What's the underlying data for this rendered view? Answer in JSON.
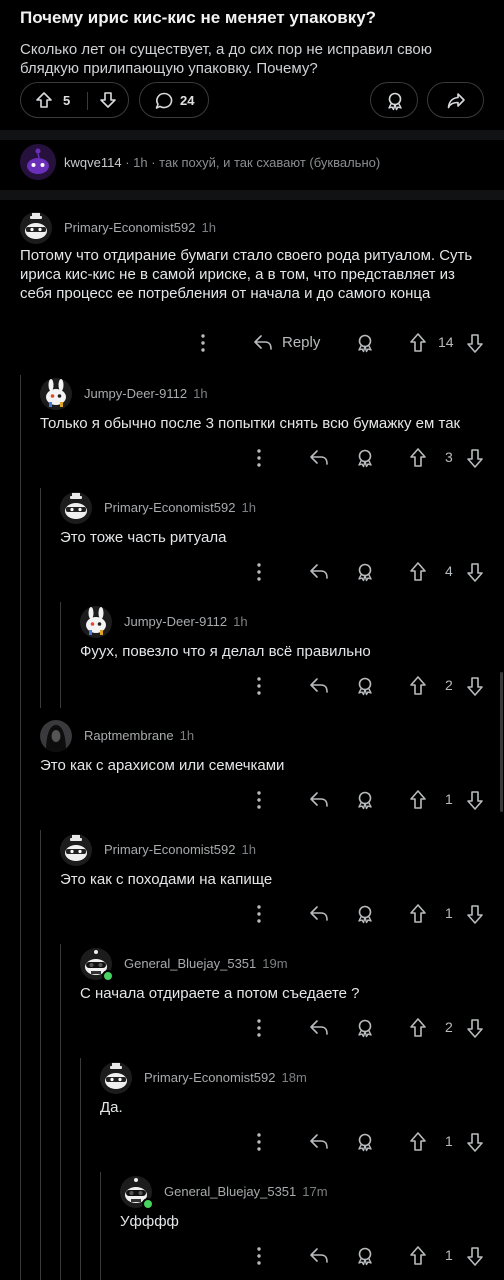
{
  "post": {
    "title": "Почему ирис кис-кис не меняет упаковку?",
    "body": "Сколько лет он существует, а до сих пор не исправил свою блядкую прилипающую упаковку. Почему?",
    "upvotes": "5",
    "comments": "24"
  },
  "top_comment": {
    "user": "kwqve114",
    "time": "1h",
    "text": "так похуй, и так схавают (буквально)"
  },
  "comments": [
    {
      "user": "Primary-Economist592",
      "time": "1h",
      "text": "Потому что отдирание бумаги стало своего рода ритуалом. Суть ириса кис-кис не в самой ириске, а в том, что представляет из себя процесс ее потребления от начала и до самого конца",
      "votes": "14",
      "reply_label": "Reply"
    },
    {
      "user": "Jumpy-Deer-9112",
      "time": "1h",
      "text": "Только я обычно после 3 попытки снять всю бумажку ем так",
      "votes": "3"
    },
    {
      "user": "Primary-Economist592",
      "time": "1h",
      "text": "Это тоже часть ритуала",
      "votes": "4"
    },
    {
      "user": "Jumpy-Deer-9112",
      "time": "1h",
      "text": "Фуух, повезло что я делал всё правильно",
      "votes": "2"
    },
    {
      "user": "Raptmembrane",
      "time": "1h",
      "text": "Это как с арахисом или семечками",
      "votes": "1"
    },
    {
      "user": "Primary-Economist592",
      "time": "1h",
      "text": "Это как с походами на капище",
      "votes": "1"
    },
    {
      "user": "General_Bluejay_5351",
      "time": "19m",
      "text": "С начала отдираете а потом съедаете ?",
      "votes": "2"
    },
    {
      "user": "Primary-Economist592",
      "time": "18m",
      "text": "Да.",
      "votes": "1"
    },
    {
      "user": "General_Bluejay_5351",
      "time": "17m",
      "text": "Уфффф",
      "votes": "1"
    }
  ],
  "colors": {
    "background": "#000000",
    "text": "#e4e6e8",
    "muted": "#8b8e90",
    "online": "#46d160"
  }
}
